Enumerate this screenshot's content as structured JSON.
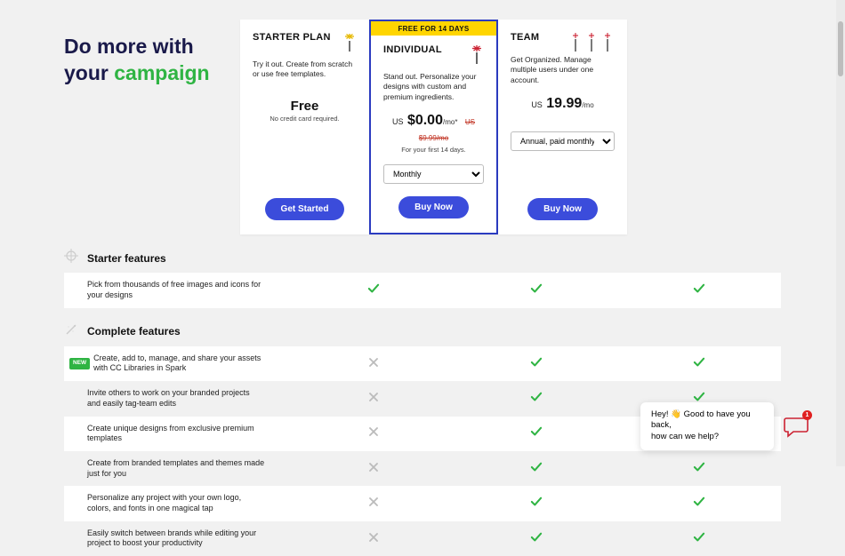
{
  "headline": {
    "line1": "Do more with",
    "line2_a": "your ",
    "line2_b": "campaign"
  },
  "plans": {
    "starter": {
      "title": "STARTER PLAN",
      "desc": "Try it out. Create from scratch or use free templates.",
      "price_free": "Free",
      "fine": "No credit card required.",
      "cta": "Get Started"
    },
    "individual": {
      "badge": "FREE FOR 14 DAYS",
      "title": "INDIVIDUAL",
      "desc": "Stand out. Personalize your designs with custom and premium ingredients.",
      "currency": "US",
      "amount": "$0.00",
      "per": "/mo*",
      "strike": "US $9.99/mo",
      "fine": "For your first 14 days.",
      "period_selected": "Monthly",
      "cta": "Buy Now"
    },
    "team": {
      "title": "TEAM",
      "desc": "Get Organized. Manage multiple users under one account.",
      "currency": "US",
      "amount": "19.99",
      "per": "/mo",
      "period_selected": "Annual, paid monthly",
      "cta": "Buy Now"
    }
  },
  "sections": {
    "starter": "Starter features",
    "complete": "Complete features"
  },
  "features": {
    "starter": [
      {
        "label": "Pick from thousands of free images and icons for your designs",
        "s": true,
        "i": true,
        "t": true,
        "new": false
      }
    ],
    "complete": [
      {
        "label": "Create, add to, manage, and share your assets with CC Libraries in Spark",
        "s": false,
        "i": true,
        "t": true,
        "new": true
      },
      {
        "label": "Invite others to work on your branded projects and easily tag-team edits",
        "s": false,
        "i": true,
        "t": true,
        "new": false
      },
      {
        "label": "Create unique designs from exclusive premium templates",
        "s": false,
        "i": true,
        "t": true,
        "new": false
      },
      {
        "label": "Create from branded templates and themes made just for you",
        "s": false,
        "i": true,
        "t": true,
        "new": false
      },
      {
        "label": "Personalize any project with your own logo, colors, and fonts in one magical tap",
        "s": false,
        "i": true,
        "t": true,
        "new": false
      },
      {
        "label": "Easily switch between brands while editing your project to boost your productivity",
        "s": false,
        "i": true,
        "t": true,
        "new": false
      }
    ]
  },
  "chat": {
    "line1": "Hey! 👋 Good to have you back,",
    "line2": "how can we help?",
    "badge": "1"
  },
  "labels": {
    "new": "NEW"
  }
}
